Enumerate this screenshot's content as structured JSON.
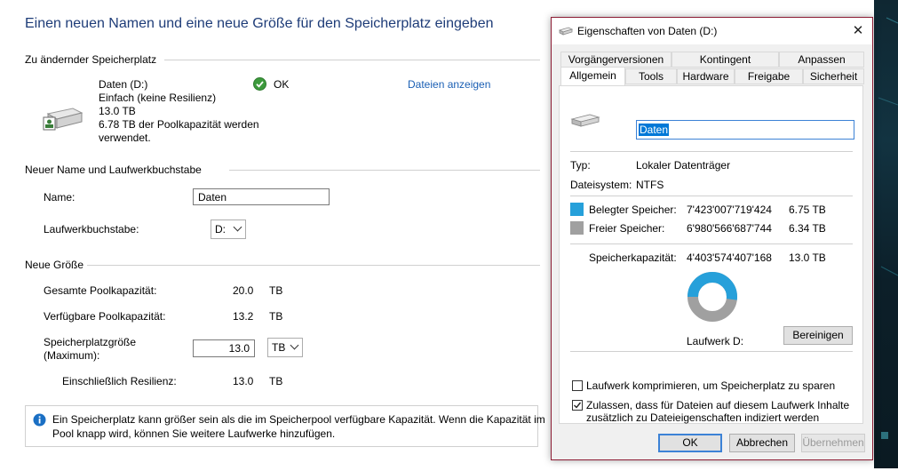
{
  "wizard": {
    "title": "Einen neuen Namen und eine neue Größe für den Speicherplatz eingeben",
    "section_storage": "Zu ändernder Speicherplatz",
    "drive_name": "Daten (D:)",
    "drive_type": "Einfach (keine Resilienz)",
    "drive_size": "13.0 TB",
    "drive_usage": "6.78 TB der Poolkapazität werden",
    "drive_usage_2": "verwendet.",
    "status": "OK",
    "show_files_link": "Dateien anzeigen",
    "section_name": "Neuer Name und Laufwerkbuchstabe",
    "name_label": "Name:",
    "name_value": "Daten",
    "letter_label": "Laufwerkbuchstabe:",
    "letter_value": "D:",
    "section_size": "Neue Größe",
    "total_label": "Gesamte Poolkapazität:",
    "total_value": "20.0",
    "total_unit": "TB",
    "avail_label": "Verfügbare Poolkapazität:",
    "avail_value": "13.2",
    "avail_unit": "TB",
    "size_label_1": "Speicherplatzgröße",
    "size_label_2": "(Maximum):",
    "size_value": "13.0",
    "size_unit": "TB",
    "resil_label": "Einschließlich Resilienz:",
    "resil_value": "13.0",
    "resil_unit": "TB",
    "info_text_1": "Ein Speicherplatz kann größer sein als die im Speicherpool verfügbare Kapazität. Wenn die Kapazität im",
    "info_text_2": "Pool knapp wird, können Sie weitere Laufwerke hinzufügen."
  },
  "dialog": {
    "title": "Eigenschaften von Daten (D:)",
    "tabs_row1": [
      "Vorgängerversionen",
      "Kontingent",
      "Anpassen"
    ],
    "tabs_row2": [
      "Allgemein",
      "Tools",
      "Hardware",
      "Freigabe",
      "Sicherheit"
    ],
    "name_value": "Daten",
    "type_label": "Typ:",
    "type_value": "Lokaler Datenträger",
    "fs_label": "Dateisystem:",
    "fs_value": "NTFS",
    "used_label": "Belegter Speicher:",
    "used_bytes": "7'423'007'719'424",
    "used_size": "6.75 TB",
    "free_label": "Freier Speicher:",
    "free_bytes": "6'980'566'687'744",
    "free_size": "6.34 TB",
    "cap_label": "Speicherkapazität:",
    "cap_bytes": "4'403'574'407'168",
    "cap_size": "13.0 TB",
    "drive_label": "Laufwerk D:",
    "cleanup_button": "Bereinigen",
    "compress_label": "Laufwerk komprimieren, um Speicherplatz zu sparen",
    "compress_checked": false,
    "index_label_1": "Zulassen, dass für Dateien auf diesem Laufwerk Inhalte",
    "index_label_2": "zusätzlich zu Dateieigenschaften indiziert werden",
    "index_checked": true,
    "ok_button": "OK",
    "cancel_button": "Abbrechen",
    "apply_button": "Übernehmen",
    "used_fraction": 0.52,
    "used_color": "#26a0da",
    "free_color": "#a0a0a0",
    "close_symbol": "✕"
  }
}
